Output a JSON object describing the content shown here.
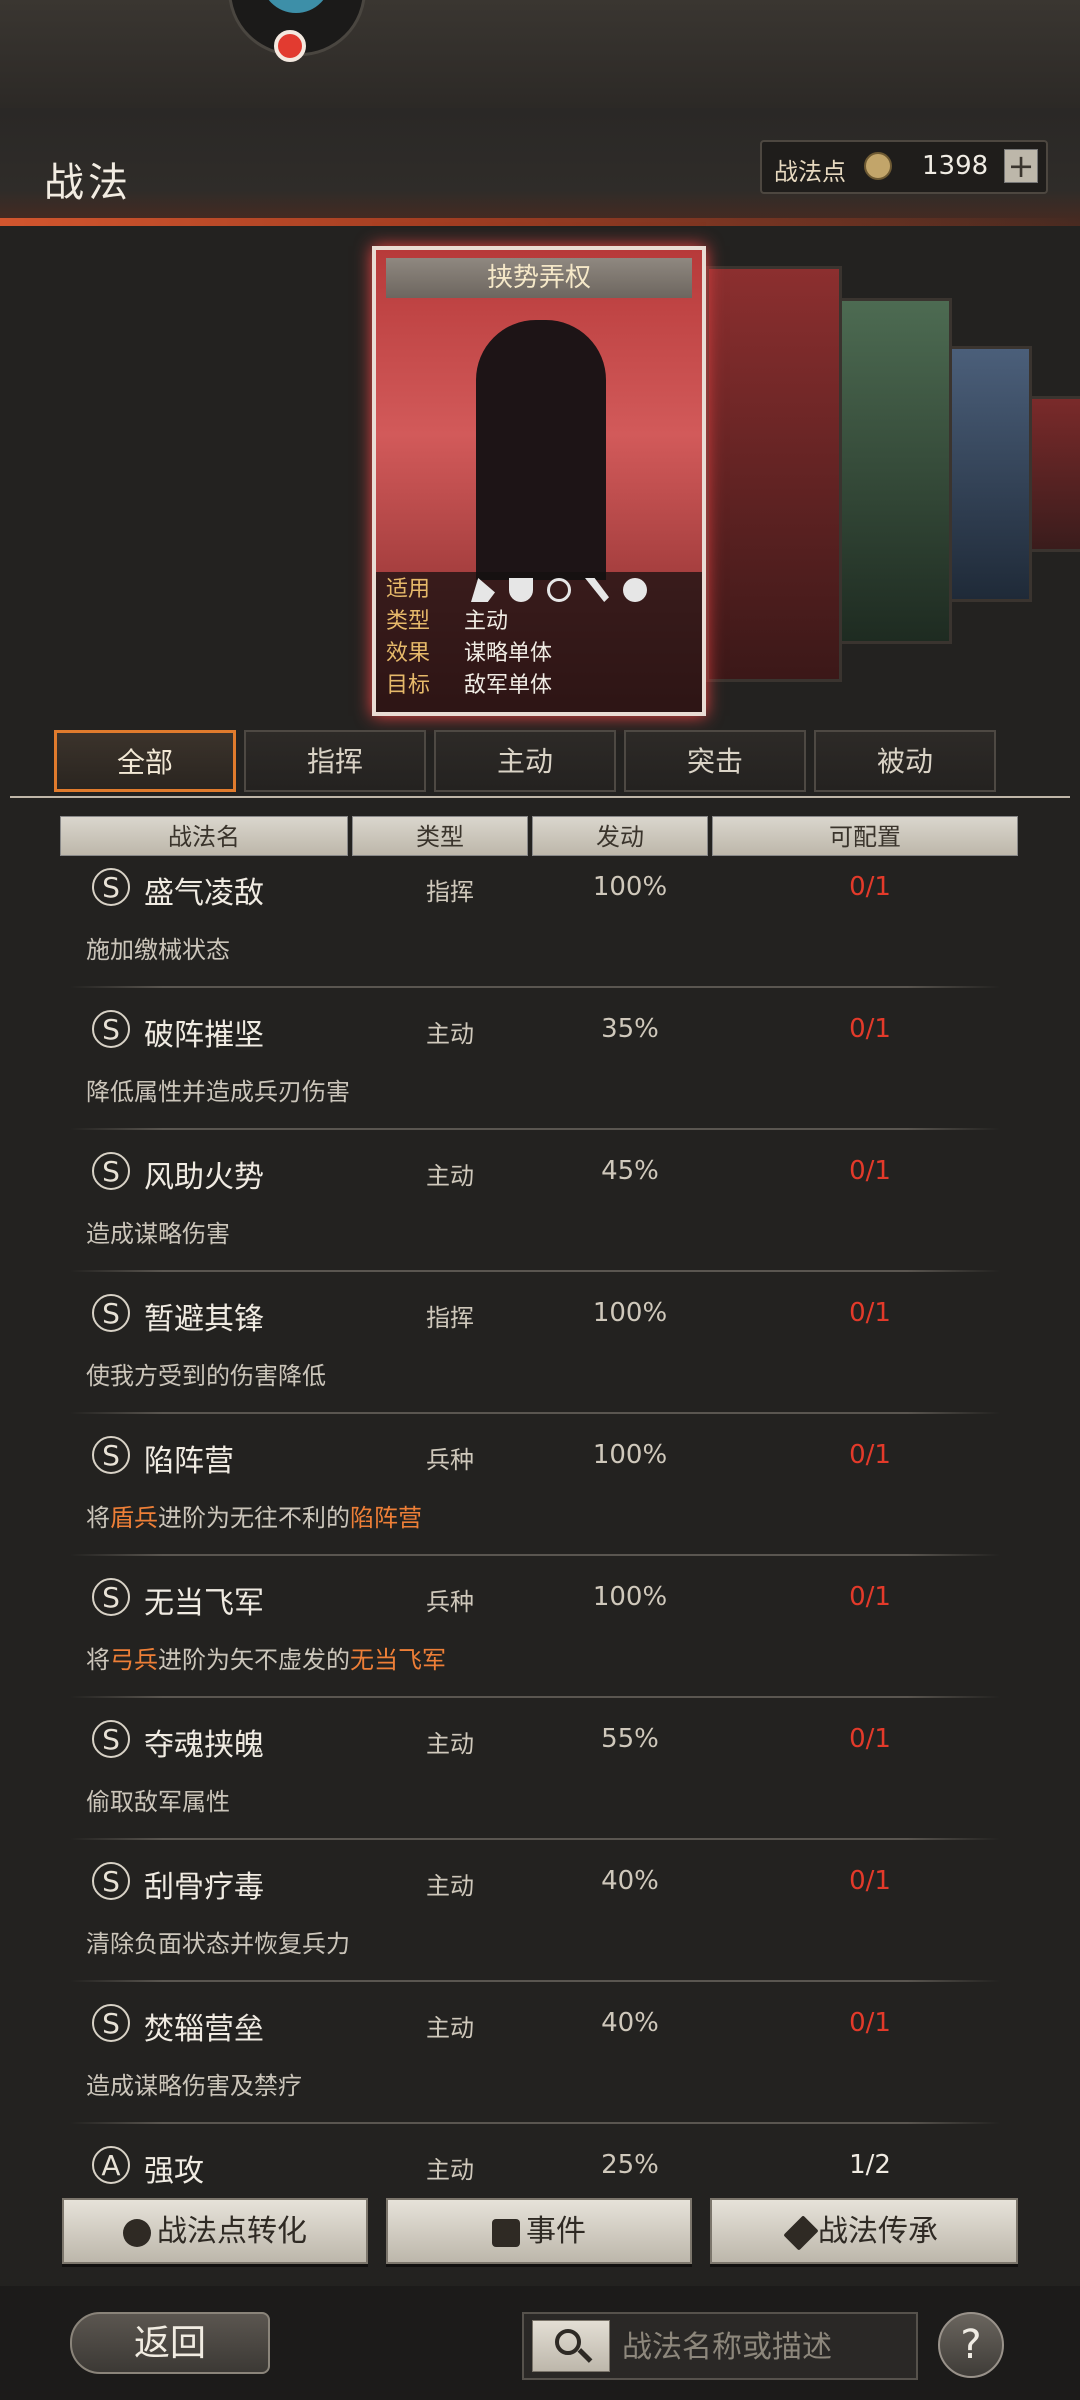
{
  "header": {
    "title": "战法",
    "points_label": "战法点",
    "points_value": "1398",
    "plus_label": "+"
  },
  "card": {
    "name": "挟势弄权",
    "fields": [
      {
        "key": "适用",
        "value": ""
      },
      {
        "key": "类型",
        "value": "主动"
      },
      {
        "key": "效果",
        "value": "谋略单体"
      },
      {
        "key": "目标",
        "value": "敌军单体"
      }
    ],
    "unit_icons": [
      "cavalry-icon",
      "shield-icon",
      "bow-icon",
      "spear-icon",
      "chariot-icon"
    ]
  },
  "tabs": [
    "全部",
    "指挥",
    "主动",
    "突击",
    "被动"
  ],
  "columns": [
    "战法名",
    "类型",
    "发动",
    "可配置"
  ],
  "skills": [
    {
      "grade": "S",
      "name": "盛气凌敌",
      "type": "指挥",
      "rate": "100%",
      "config": "0/1",
      "desc": [
        {
          "t": "施加缴械状态",
          "hl": false
        }
      ]
    },
    {
      "grade": "S",
      "name": "破阵摧坚",
      "type": "主动",
      "rate": "35%",
      "config": "0/1",
      "desc": [
        {
          "t": "降低属性并造成兵刃伤害",
          "hl": false
        }
      ]
    },
    {
      "grade": "S",
      "name": "风助火势",
      "type": "主动",
      "rate": "45%",
      "config": "0/1",
      "desc": [
        {
          "t": "造成谋略伤害",
          "hl": false
        }
      ]
    },
    {
      "grade": "S",
      "name": "暂避其锋",
      "type": "指挥",
      "rate": "100%",
      "config": "0/1",
      "desc": [
        {
          "t": "使我方受到的伤害降低",
          "hl": false
        }
      ]
    },
    {
      "grade": "S",
      "name": "陷阵营",
      "type": "兵种",
      "rate": "100%",
      "config": "0/1",
      "desc": [
        {
          "t": "将",
          "hl": false
        },
        {
          "t": "盾兵",
          "hl": true
        },
        {
          "t": "进阶为无往不利的",
          "hl": false
        },
        {
          "t": "陷阵营",
          "hl": true
        }
      ]
    },
    {
      "grade": "S",
      "name": "无当飞军",
      "type": "兵种",
      "rate": "100%",
      "config": "0/1",
      "desc": [
        {
          "t": "将",
          "hl": false
        },
        {
          "t": "弓兵",
          "hl": true
        },
        {
          "t": "进阶为矢不虚发的",
          "hl": false
        },
        {
          "t": "无当飞军",
          "hl": true
        }
      ]
    },
    {
      "grade": "S",
      "name": "夺魂挟魄",
      "type": "主动",
      "rate": "55%",
      "config": "0/1",
      "desc": [
        {
          "t": "偷取敌军属性",
          "hl": false
        }
      ]
    },
    {
      "grade": "S",
      "name": "刮骨疗毒",
      "type": "主动",
      "rate": "40%",
      "config": "0/1",
      "desc": [
        {
          "t": "清除负面状态并恢复兵力",
          "hl": false
        }
      ]
    },
    {
      "grade": "S",
      "name": "焚辎营垒",
      "type": "主动",
      "rate": "40%",
      "config": "0/1",
      "desc": [
        {
          "t": "造成谋略伤害及禁疗",
          "hl": false
        }
      ]
    },
    {
      "grade": "A",
      "name": "强攻",
      "type": "主动",
      "rate": "25%",
      "config": "1/2",
      "desc": []
    }
  ],
  "actions": {
    "convert": "战法点转化",
    "events": "事件",
    "inherit": "战法传承"
  },
  "footer": {
    "back": "返回",
    "search_placeholder": "战法名称或描述",
    "help": "?"
  },
  "colors": {
    "accent": "#e07b2d",
    "config_unavailable": "#e33a2a",
    "highlight": "#ee7f37"
  }
}
